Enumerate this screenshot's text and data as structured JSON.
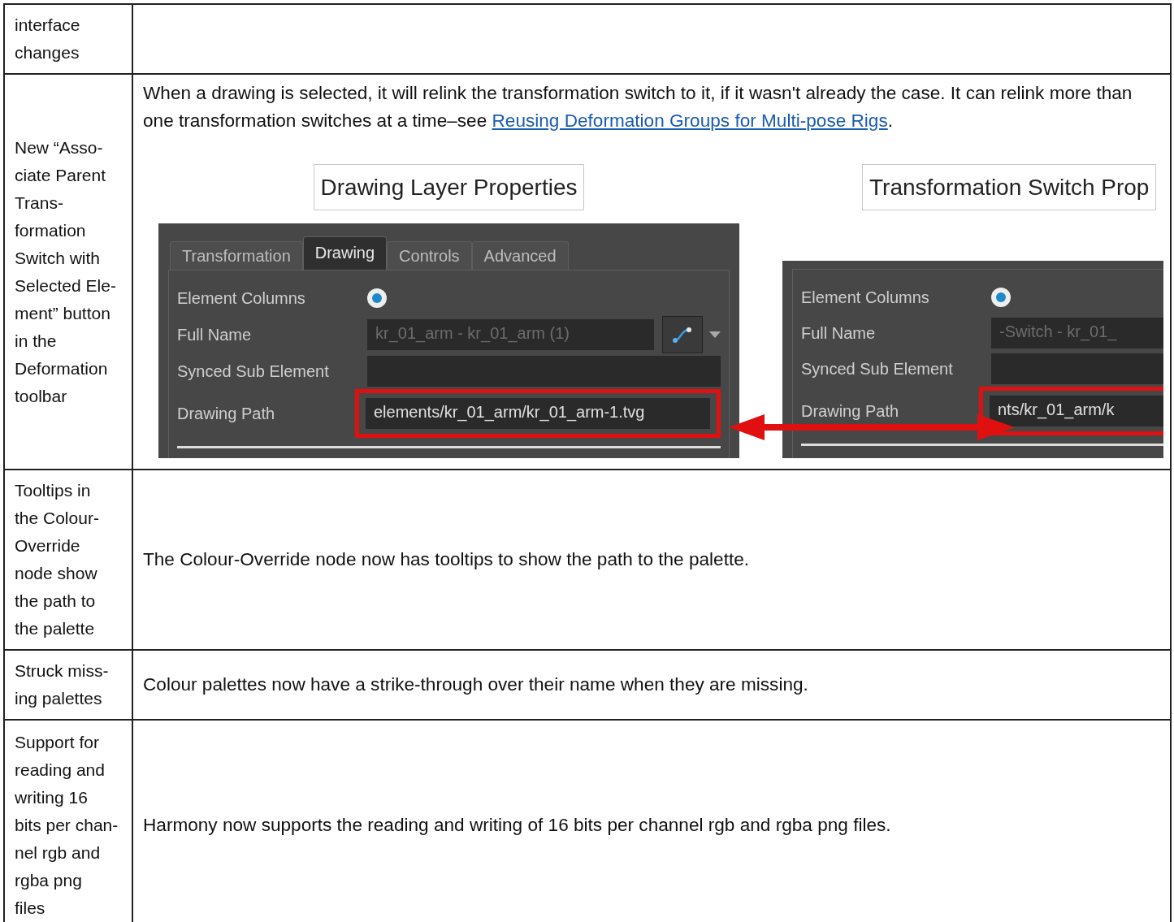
{
  "rows": [
    {
      "feature": "interface\nchanges"
    },
    {
      "feature": "New “Asso-\nciate Parent\nTrans-\nformation\nSwitch with\nSelected Ele-\nment” button\nin the\nDeformation\ntoolbar",
      "description": "When a drawing is selected, it will relink the transformation switch to it, if it wasn't already the case. It can relink more than one transformation switches at a time–see ",
      "link": "Reusing Deformation Groups for Multi-pose Rigs",
      "description_end": ".",
      "figure": {
        "panels": [
          {
            "title": "Drawing Layer Properties",
            "tabs": [
              {
                "label": "Transformation",
                "selected": false
              },
              {
                "label": "Drawing",
                "selected": true
              },
              {
                "label": "Controls",
                "selected": false
              },
              {
                "label": "Advanced",
                "selected": false
              }
            ],
            "fields": [
              {
                "kind": "radio",
                "label": "Element Columns",
                "checked": true
              },
              {
                "kind": "text_button",
                "label": "Full Name",
                "value": "kr_01_arm - kr_01_arm (1)",
                "disabled": true
              },
              {
                "kind": "text",
                "label": "Synced Sub Element"
              },
              {
                "kind": "text",
                "label": "Drawing Path",
                "value": "elements/kr_01_arm/kr_01_arm-1.tvg",
                "highlighted": true
              }
            ]
          },
          {
            "title": "Transformation Switch Prop",
            "fields": [
              {
                "kind": "radio",
                "label": "Element Columns",
                "checked": true
              },
              {
                "kind": "text",
                "label": "Full Name",
                "value": "-Switch - kr_01_",
                "disabled": true
              },
              {
                "kind": "text",
                "label": "Synced Sub Element"
              },
              {
                "kind": "text",
                "label": "Drawing Path",
                "value": "nts/kr_01_arm/k",
                "highlighted": true
              }
            ]
          }
        ]
      }
    },
    {
      "feature": "Tooltips in\nthe Colour-\nOverride\nnode show\nthe path to\nthe palette",
      "description": "The Colour-Override node now has tooltips to show the path to the palette."
    },
    {
      "feature": "Struck miss-\ning palettes",
      "description": "Colour palettes now have a strike-through over their name when they are missing."
    },
    {
      "feature": "Support for\nreading and\nwriting 16\nbits per chan-\nnel rgb and\nrgba png\nfiles",
      "description": "Harmony now supports the reading and writing of 16 bits per channel rgb and rgba png files."
    }
  ]
}
